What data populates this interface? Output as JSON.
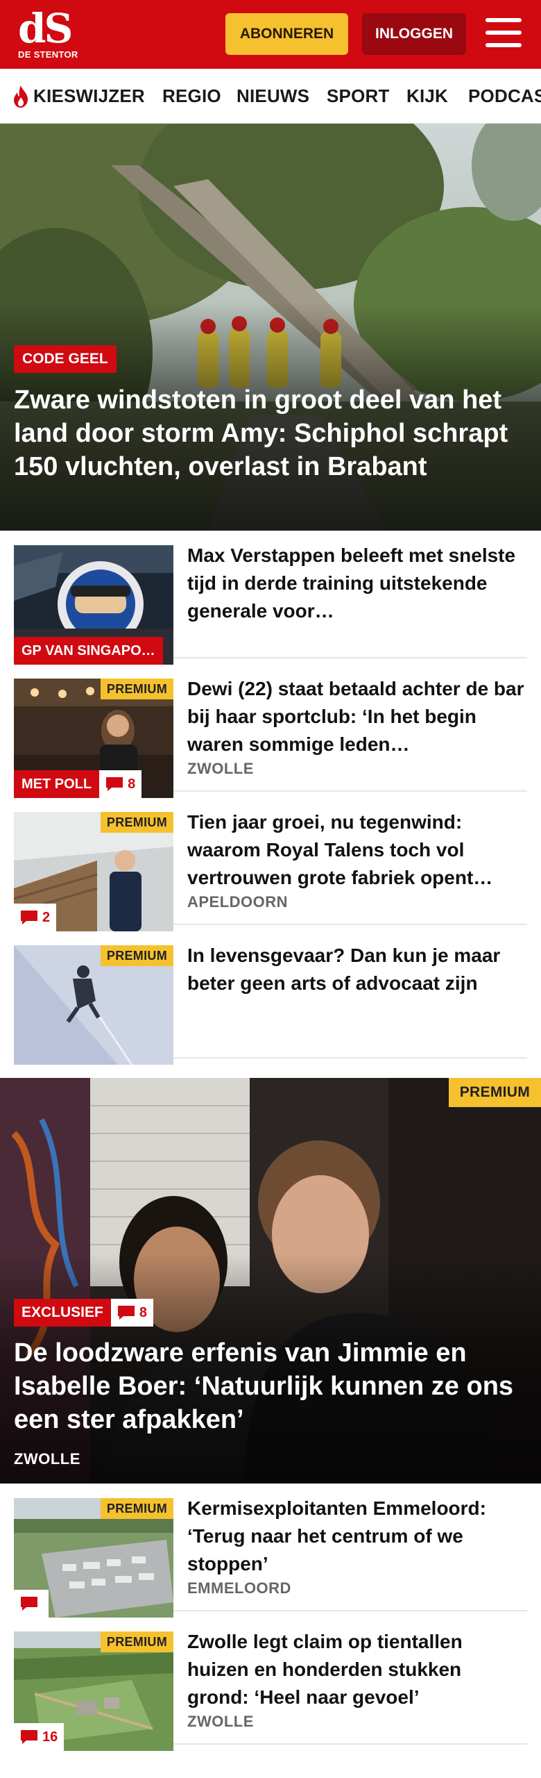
{
  "header": {
    "logo_mark": "dS",
    "logo_name": "DE STENTOR",
    "subscribe_label": "ABONNEREN",
    "login_label": "INLOGGEN",
    "brand_color": "#d10a11",
    "accent_color": "#f5c12e",
    "menu_icon": "hamburger-menu-icon"
  },
  "nav": {
    "items": [
      {
        "label": "KIESWIJZER",
        "icon": "flame-icon"
      },
      {
        "label": "REGIO"
      },
      {
        "label": "NIEUWS"
      },
      {
        "label": "SPORT"
      },
      {
        "label": "KIJK"
      },
      {
        "label": "PODCAS"
      }
    ]
  },
  "hero": {
    "tag": "CODE GEEL",
    "title": "Zware windstoten in groot deel van het land door storm Amy: Schiphol schrapt 150 vluchten, overlast in Brabant"
  },
  "articles": [
    {
      "title": "Max Verstappen beleeft met snelste tijd in derde training uitstekende generale voor…",
      "tag": "GP VAN SINGAPO…",
      "premium": "",
      "comments": "",
      "place": ""
    },
    {
      "title": "Dewi (22) staat betaald achter de bar bij haar sportclub: ‘In het begin waren sommige leden…",
      "tag": "MET POLL",
      "premium": "PREMIUM",
      "comments": "8",
      "place": "ZWOLLE"
    },
    {
      "title": "Tien jaar groei, nu tegenwind: waarom Royal Talens toch vol vertrouwen grote fabriek opent…",
      "tag": "",
      "premium": "PREMIUM",
      "comments": "2",
      "place": "APELDOORN"
    },
    {
      "title": "In levensgevaar? Dan kun je maar beter geen arts of advocaat zijn",
      "tag": "",
      "premium": "PREMIUM",
      "comments": "",
      "place": ""
    }
  ],
  "feature": {
    "premium": "PREMIUM",
    "tag": "EXCLUSIEF",
    "comments": "8",
    "title": "De loodzware erfenis van Jimmie en Isabelle Boer: ‘Natuurlijk kunnen ze ons een ster afpakken’",
    "place": "ZWOLLE"
  },
  "articles_bottom": [
    {
      "title": "Kermisexploitanten Emmeloord: ‘Terug naar het centrum of we stoppen’",
      "premium": "PREMIUM",
      "comments": "",
      "place": "EMMELOORD"
    },
    {
      "title": "Zwolle legt claim op tientallen huizen en honderden stukken grond: ‘Heel naar gevoel’",
      "premium": "PREMIUM",
      "comments": "16",
      "place": "ZWOLLE"
    }
  ]
}
